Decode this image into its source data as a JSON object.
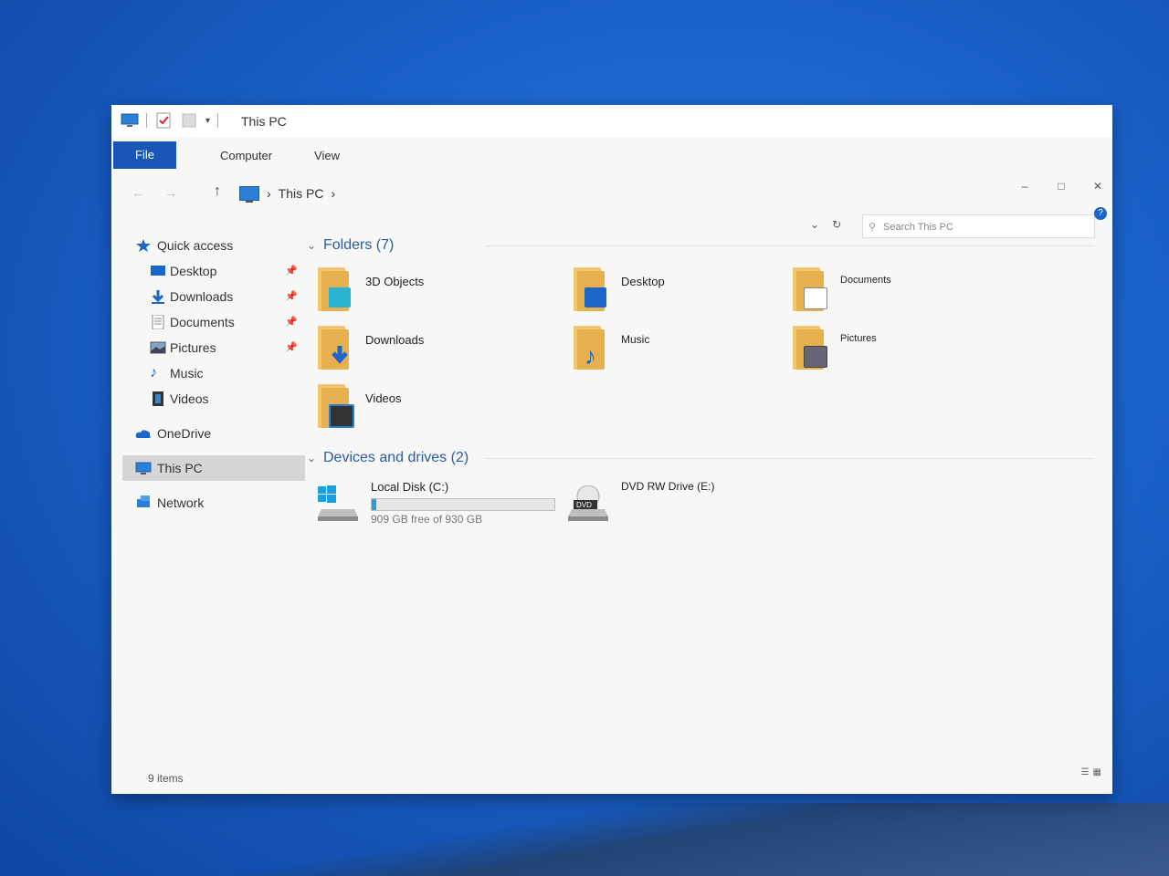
{
  "window": {
    "title": "This PC",
    "controls": [
      "–",
      "□",
      "✕"
    ]
  },
  "ribbon": {
    "tabs": [
      "File",
      "Computer",
      "View"
    ]
  },
  "address": {
    "back": "←",
    "forward": "→",
    "up": "↑",
    "crumb_sep": "›",
    "location": "This PC",
    "search_placeholder": "Search This PC"
  },
  "sidebar": {
    "quick_access": "Quick access",
    "pinned": [
      "Desktop",
      "Downloads",
      "Documents",
      "Pictures"
    ],
    "unpinned": [
      "Music",
      "Videos"
    ],
    "onedrive": "OneDrive",
    "this_pc": "This PC",
    "network": "Network"
  },
  "folders": {
    "heading": "Folders (7)",
    "items": [
      "3D Objects",
      "Desktop",
      "Documents",
      "Downloads",
      "Music",
      "Pictures",
      "Videos"
    ]
  },
  "drives": {
    "heading": "Devices and drives (2)",
    "items": [
      {
        "name": "Local Disk (C:)",
        "free": "909 GB free of 930 GB",
        "used_fraction": 0.023
      },
      {
        "name": "DVD RW Drive (E:)",
        "label": "DVD"
      }
    ]
  },
  "status": {
    "count": "9 items"
  },
  "colors": {
    "accent": "#1a56b8",
    "folder": "#e6b04f",
    "drive_fill": "#26a0da"
  }
}
